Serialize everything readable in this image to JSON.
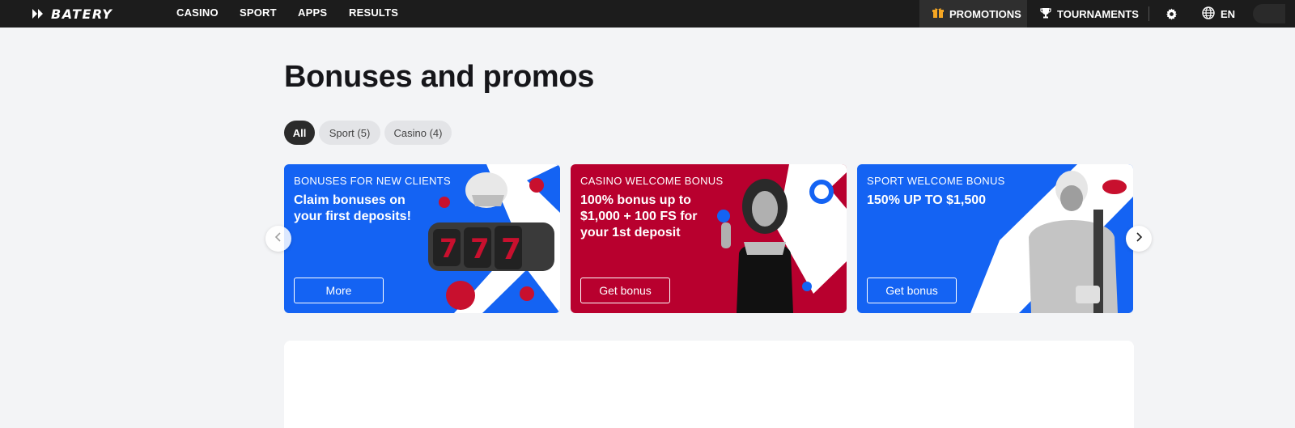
{
  "brand": {
    "name": "BATERY"
  },
  "nav": {
    "links": [
      "CASINO",
      "SPORT",
      "APPS",
      "RESULTS"
    ],
    "promotions": "PROMOTIONS",
    "tournaments": "TOURNAMENTS",
    "language": "EN"
  },
  "page": {
    "title": "Bonuses and promos"
  },
  "filters": [
    "All",
    "Sport (5)",
    "Casino (4)"
  ],
  "cards": [
    {
      "eyebrow": "BONUSES FOR NEW CLIENTS",
      "title": "Claim bonuses on your first deposits!",
      "button": "More",
      "color": "#1463f3"
    },
    {
      "eyebrow": "CASINO WELCOME BONUS",
      "title": "100% bonus up to $1,000 + 100 FS for your 1st deposit",
      "button": "Get bonus",
      "color": "#b8002e"
    },
    {
      "eyebrow": "SPORT WELCOME BONUS",
      "title": "150% UP TO $1,500",
      "button": "Get bonus",
      "color": "#1463f3"
    }
  ],
  "icons": [
    "gift-icon",
    "trophy-icon",
    "gear-icon",
    "globe-icon",
    "chevron-left-icon",
    "chevron-right-icon"
  ]
}
